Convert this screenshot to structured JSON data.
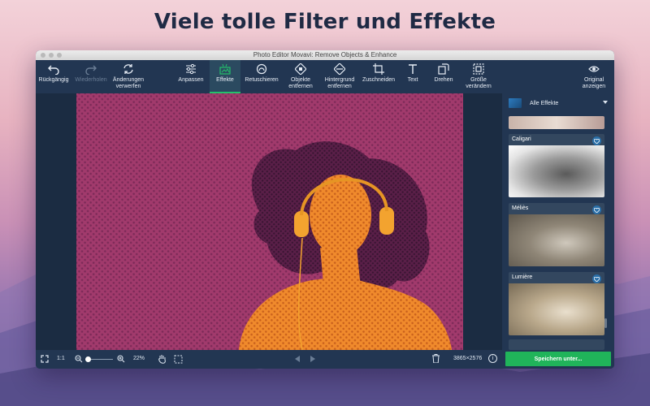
{
  "headline": "Viele tolle Filter und Effekte",
  "window": {
    "title": "Photo Editor Movavi: Remove Objects & Enhance"
  },
  "toolbar": {
    "undo": "Rückgängig",
    "redo": "Wiederholen",
    "discard_line1": "Änderungen",
    "discard_line2": "verwerfen",
    "adjust": "Anpassen",
    "effects": "Effekte",
    "retouch": "Retuschieren",
    "remove_objects_line1": "Objekte",
    "remove_objects_line2": "entfernen",
    "remove_bg_line1": "Hintergrund",
    "remove_bg_line2": "entfernen",
    "crop": "Zuschneiden",
    "text": "Text",
    "rotate": "Drehen",
    "resize_line1": "Größe",
    "resize_line2": "verändern",
    "original_line1": "Original",
    "original_line2": "anzeigen"
  },
  "effects_panel": {
    "category": "Alle Effekte",
    "items": [
      "Caligari",
      "Méliès",
      "Lumière"
    ]
  },
  "bottombar": {
    "ratio": "1:1",
    "zoom": "22%",
    "dimensions": "3865×2576",
    "save": "Speichern unter..."
  },
  "colors": {
    "accent": "#23c16b",
    "window_bg": "#1b2c42",
    "toolbar_bg": "#223652",
    "photo_magenta": "#a13a6c",
    "photo_orange": "#f08a2c"
  }
}
